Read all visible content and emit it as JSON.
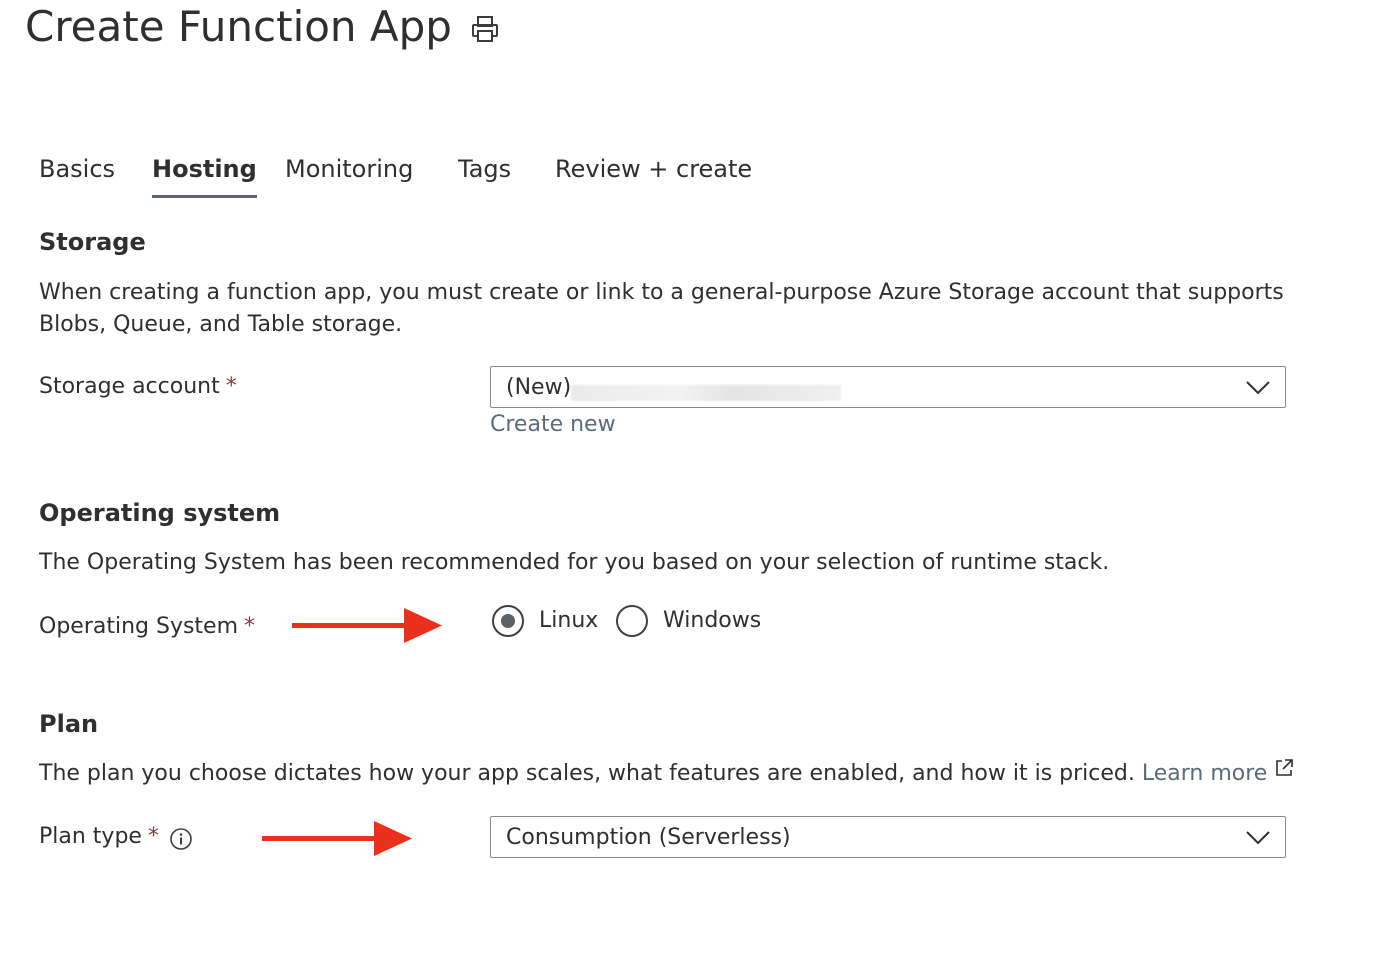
{
  "header": {
    "title": "Create Function App",
    "print_icon": "printer-icon"
  },
  "tabs": [
    {
      "label": "Basics",
      "active": false
    },
    {
      "label": "Hosting",
      "active": true
    },
    {
      "label": "Monitoring",
      "active": false
    },
    {
      "label": "Tags",
      "active": false
    },
    {
      "label": "Review + create",
      "active": false
    }
  ],
  "storage": {
    "title": "Storage",
    "description": "When creating a function app, you must create or link to a general-purpose Azure Storage account that supports Blobs, Queue, and Table storage.",
    "field_label": "Storage account",
    "required_mark": "*",
    "value_prefix": "(New)",
    "create_new": "Create new"
  },
  "os": {
    "title": "Operating system",
    "description": "The Operating System has been recommended for you based on your selection of runtime stack.",
    "field_label": "Operating System",
    "required_mark": "*",
    "options": [
      {
        "label": "Linux",
        "selected": true
      },
      {
        "label": "Windows",
        "selected": false
      }
    ]
  },
  "plan": {
    "title": "Plan",
    "description": "The plan you choose dictates how your app scales, what features are enabled, and how it is priced.",
    "learn_more": "Learn more",
    "field_label": "Plan type",
    "required_mark": "*",
    "value": "Consumption (Serverless)"
  },
  "colors": {
    "annotation_arrow": "#e8301c",
    "active_tab_underline": "#5c6470",
    "link": "#5a6b7c"
  }
}
